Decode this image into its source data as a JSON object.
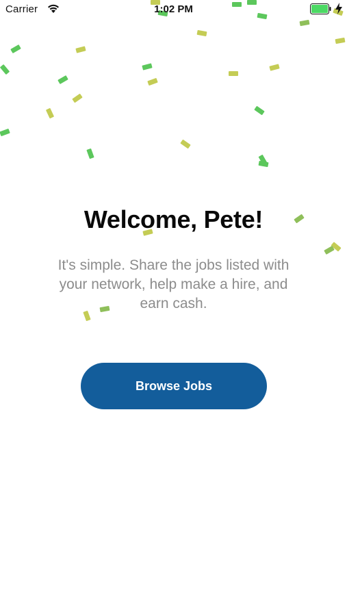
{
  "status_bar": {
    "carrier": "Carrier",
    "time": "1:02 PM",
    "wifi_icon": "wifi-icon",
    "battery_icon": "battery-full-icon",
    "charging_icon": "charging-bolt-icon",
    "battery_color": "#4cd964"
  },
  "welcome": {
    "title": "Welcome, Pete!",
    "line1": "It's simple. Share the jobs listed with",
    "line2": "your network, help make a hire, and",
    "line3": "earn cash."
  },
  "actions": {
    "browse_label": "Browse Jobs"
  },
  "colors": {
    "button": "#135d9b",
    "confetti_green": "#5cc75c",
    "confetti_yellow": "#c4cc55",
    "confetti_olive": "#8fbf5a",
    "subtitle": "#8c8c8c"
  }
}
